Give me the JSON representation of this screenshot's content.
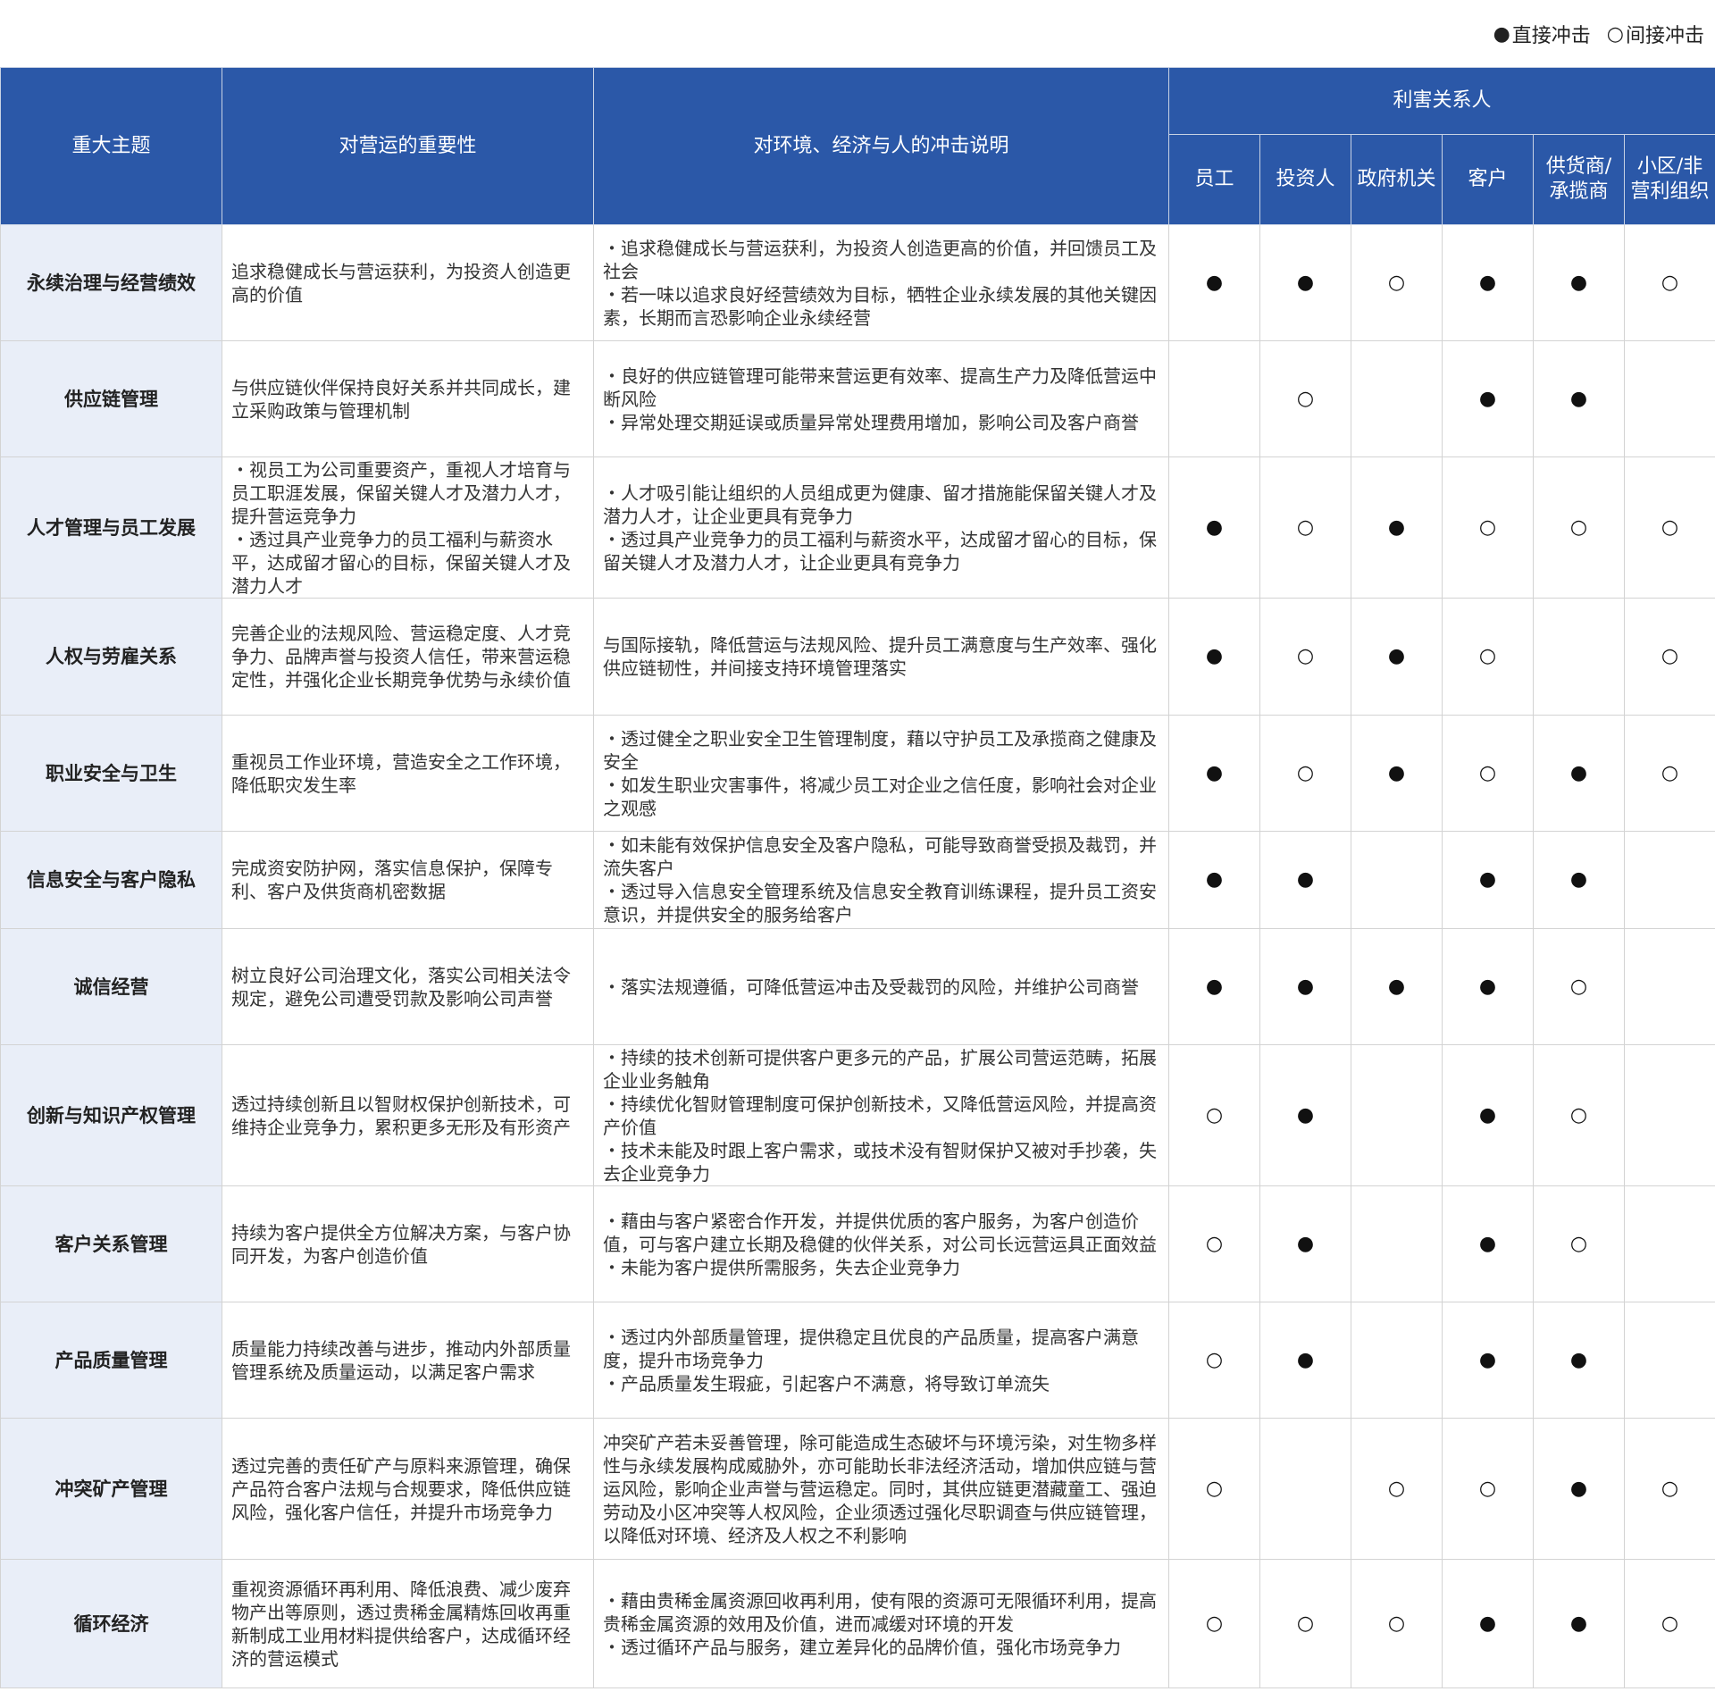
{
  "legend": {
    "direct_symbol": "●",
    "direct_label": "直接冲击",
    "indirect_symbol": "○",
    "indirect_label": "间接冲击"
  },
  "header": {
    "topic": "重大主题",
    "importance": "对营运的重要性",
    "impact": "对环境、经济与人的冲击说明",
    "stakeholders": "利害关系人",
    "stakeholder_columns": [
      "员工",
      "投资人",
      "政府机关",
      "客户",
      "供货商/承揽商",
      "小区/非营利组织"
    ]
  },
  "colors": {
    "header_bg": "#2b58a8",
    "topic_bg": "#e9eef8"
  },
  "rows": [
    {
      "topic": "永续治理与经营绩效",
      "importance": "追求稳健成长与营运获利，为投资人创造更高的价值",
      "impact": "・追求稳健成长与营运获利，为投资人创造更高的价值，并回馈员工及社会\n・若一味以追求良好经营绩效为目标，牺牲企业永续发展的其他关键因素，长期而言恐影响企业永续经营",
      "marks": [
        "●",
        "●",
        "○",
        "●",
        "●",
        "○"
      ]
    },
    {
      "topic": "供应链管理",
      "importance": "与供应链伙伴保持良好关系并共同成长，建立采购政策与管理机制",
      "impact": "・良好的供应链管理可能带来营运更有效率、提高生产力及降低营运中断风险\n・异常处理交期延误或质量异常处理费用增加，影响公司及客户商誉",
      "marks": [
        "",
        "○",
        "",
        "●",
        "●",
        ""
      ]
    },
    {
      "topic": "人才管理与员工发展",
      "importance": "・视员工为公司重要资产，重视人才培育与员工职涯发展，保留关键人才及潜力人才，提升营运竞争力\n・透过具产业竞争力的员工福利与薪资水平，达成留才留心的目标，保留关键人才及潜力人才",
      "impact": "・人才吸引能让组织的人员组成更为健康、留才措施能保留关键人才及潜力人才，让企业更具有竞争力\n・透过具产业竞争力的员工福利与薪资水平，达成留才留心的目标，保留关键人才及潜力人才，让企业更具有竞争力",
      "marks": [
        "●",
        "○",
        "●",
        "○",
        "○",
        "○"
      ]
    },
    {
      "topic": "人权与劳雇关系",
      "importance": "完善企业的法规风险、营运稳定度、人才竞争力、品牌声誉与投资人信任，带来营运稳定性，并强化企业长期竞争优势与永续价值",
      "impact": "与国际接轨，降低营运与法规风险、提升员工满意度与生产效率、强化供应链韧性，并间接支持环境管理落实",
      "marks": [
        "●",
        "○",
        "●",
        "○",
        "",
        "○"
      ]
    },
    {
      "topic": "职业安全与卫生",
      "importance": "重视员工作业环境，营造安全之工作环境，降低职灾发生率",
      "impact": "・透过健全之职业安全卫生管理制度，藉以守护员工及承揽商之健康及安全\n・如发生职业灾害事件，将减少员工对企业之信任度，影响社会对企业之观感",
      "marks": [
        "●",
        "○",
        "●",
        "○",
        "●",
        "○"
      ]
    },
    {
      "topic": "信息安全与客户隐私",
      "importance": "完成资安防护网，落实信息保护，保障专利、客户及供货商机密数据",
      "impact": "・如未能有效保护信息安全及客户隐私，可能导致商誉受损及裁罚，并流失客户\n・透过导入信息安全管理系统及信息安全教育训练课程，提升员工资安意识，并提供安全的服务给客户",
      "marks": [
        "●",
        "●",
        "",
        "●",
        "●",
        ""
      ]
    },
    {
      "topic": "诚信经营",
      "importance": "树立良好公司治理文化，落实公司相关法令规定，避免公司遭受罚款及影响公司声誉",
      "impact": "・落实法规遵循，可降低营运冲击及受裁罚的风险，并维护公司商誉",
      "marks": [
        "●",
        "●",
        "●",
        "●",
        "○",
        ""
      ]
    },
    {
      "topic": "创新与知识产权管理",
      "importance": "透过持续创新且以智财权保护创新技术，可维持企业竞争力，累积更多无形及有形资产",
      "impact": "・持续的技术创新可提供客户更多元的产品，扩展公司营运范畴，拓展企业业务触角\n・持续优化智财管理制度可保护创新技术，又降低营运风险，并提高资产价值\n・技术未能及时跟上客户需求，或技术没有智财保护又被对手抄袭，失去企业竞争力",
      "marks": [
        "○",
        "●",
        "",
        "●",
        "○",
        ""
      ]
    },
    {
      "topic": "客户关系管理",
      "importance": "持续为客户提供全方位解决方案，与客户协同开发，为客户创造价值",
      "impact": "・藉由与客户紧密合作开发，并提供优质的客户服务，为客户创造价值，可与客户建立长期及稳健的伙伴关系，对公司长远营运具正面效益\n・未能为客户提供所需服务，失去企业竞争力",
      "marks": [
        "○",
        "●",
        "",
        "●",
        "○",
        ""
      ]
    },
    {
      "topic": "产品质量管理",
      "importance": "质量能力持续改善与进步，推动内外部质量管理系统及质量运动，以满足客户需求",
      "impact": "・透过内外部质量管理，提供稳定且优良的产品质量，提高客户满意度，提升市场竞争力\n・产品质量发生瑕疵，引起客户不满意，将导致订单流失",
      "marks": [
        "○",
        "●",
        "",
        "●",
        "●",
        ""
      ]
    },
    {
      "topic": "冲突矿产管理",
      "importance": "透过完善的责任矿产与原料来源管理，确保产品符合客户法规与合规要求，降低供应链风险，强化客户信任，并提升市场竞争力",
      "impact": "冲突矿产若未妥善管理，除可能造成生态破坏与环境污染，对生物多样性与永续发展构成威胁外，亦可能助长非法经济活动，增加供应链与营运风险，影响企业声誉与营运稳定。同时，其供应链更潜藏童工、强迫劳动及小区冲突等人权风险，企业须透过强化尽职调查与供应链管理，以降低对环境、经济及人权之不利影响",
      "marks": [
        "○",
        "",
        "○",
        "○",
        "●",
        "○"
      ]
    },
    {
      "topic": "循环经济",
      "importance": "重视资源循环再利用、降低浪费、减少废弃物产出等原则，透过贵稀金属精炼回收再重新制成工业用材料提供给客户，达成循环经济的营运模式",
      "impact": "・藉由贵稀金属资源回收再利用，使有限的资源可无限循环利用，提高贵稀金属资源的效用及价值，进而减缓对环境的开发\n・透过循环产品与服务，建立差异化的品牌价值，强化市场竞争力",
      "marks": [
        "○",
        "○",
        "○",
        "●",
        "●",
        "○"
      ]
    }
  ]
}
